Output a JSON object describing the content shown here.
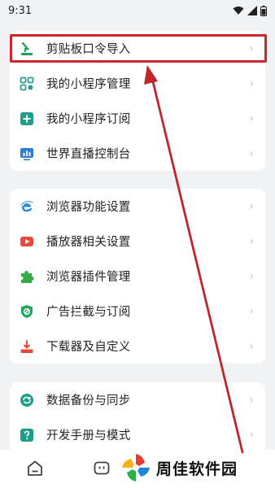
{
  "status_bar": {
    "time": "9:31"
  },
  "groups": [
    {
      "items": [
        {
          "label": "剪贴板口令导入",
          "icon": "clipboard-import-icon",
          "color": "#1e9e5a"
        },
        {
          "label": "我的小程序管理",
          "icon": "grid-icon",
          "color": "#2a9d8f"
        },
        {
          "label": "我的小程序订阅",
          "icon": "subscribe-icon",
          "color": "#1e9e8a"
        },
        {
          "label": "世界直播控制台",
          "icon": "live-console-icon",
          "color": "#2a7fd4"
        }
      ]
    },
    {
      "items": [
        {
          "label": "浏览器功能设置",
          "icon": "browser-e-icon",
          "color": "#2a8ad8"
        },
        {
          "label": "播放器相关设置",
          "icon": "player-icon",
          "color": "#e64a3c"
        },
        {
          "label": "浏览器插件管理",
          "icon": "puzzle-icon",
          "color": "#3aa84a"
        },
        {
          "label": "广告拦截与订阅",
          "icon": "shield-icon",
          "color": "#1ea85a"
        },
        {
          "label": "下载器及自定义",
          "icon": "download-icon",
          "color": "#e64a3c"
        }
      ]
    },
    {
      "items": [
        {
          "label": "数据备份与同步",
          "icon": "sync-icon",
          "color": "#1e9e8a"
        },
        {
          "label": "开发手册与模式",
          "icon": "help-icon",
          "color": "#1e9e8a"
        }
      ]
    }
  ],
  "watermark": {
    "text": "周佳软件园"
  },
  "colors": {
    "highlight": "#d0262b",
    "arrow": "#c0262b",
    "accent": "#1e9e8a"
  }
}
